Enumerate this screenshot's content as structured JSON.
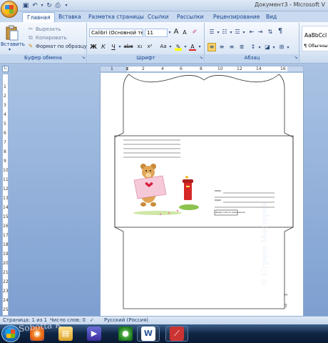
{
  "title_bar": {
    "doc_title": "Документ3 - Microsoft V"
  },
  "tabs": [
    {
      "label": "Главная"
    },
    {
      "label": "Вставка"
    },
    {
      "label": "Разметка страницы"
    },
    {
      "label": "Ссылки"
    },
    {
      "label": "Рассылки"
    },
    {
      "label": "Рецензирование"
    },
    {
      "label": "Вид"
    }
  ],
  "clipboard": {
    "paste_label": "Вставить",
    "cut_label": "Вырезать",
    "copy_label": "Копировать",
    "format_painter_label": "Формат по образцу",
    "group_label": "Буфер обмена"
  },
  "font": {
    "font_name": "Calibri (Основной те",
    "font_size": "11",
    "group_label": "Шрифт",
    "bold": "Ж",
    "italic": "К",
    "underline": "Ч",
    "strike": "abe",
    "subscript": "x₂",
    "superscript": "x²",
    "case": "Aa",
    "grow": "A",
    "shrink": "A",
    "font_color": "A"
  },
  "paragraph": {
    "group_label": "Абзац"
  },
  "styles": {
    "sample": "AaBbCcI",
    "name": "¶ Обычный"
  },
  "ruler": {
    "h_numbers": [
      "1",
      "2",
      "4",
      "6",
      "8",
      "10",
      "12",
      "14",
      "16"
    ],
    "v_numbers": [
      "1",
      "2",
      "3",
      "4",
      "5",
      "6",
      "7",
      "8",
      "9",
      "10",
      "11",
      "12",
      "13",
      "14",
      "15",
      "16",
      "17",
      "18",
      "19",
      "20",
      "21",
      "22",
      "23",
      "24",
      "25",
      "26"
    ]
  },
  "envelope": {
    "to_label": "кому",
    "where_label": "куда",
    "index_label": "Индекс места назначения"
  },
  "status_bar": {
    "page": "Страница: 1 из 1",
    "words": "Число слов: 0",
    "language": "Русский (Россия)"
  },
  "watermarks": {
    "left": "Sobotta K",
    "right": "© Страна Мастеров"
  }
}
